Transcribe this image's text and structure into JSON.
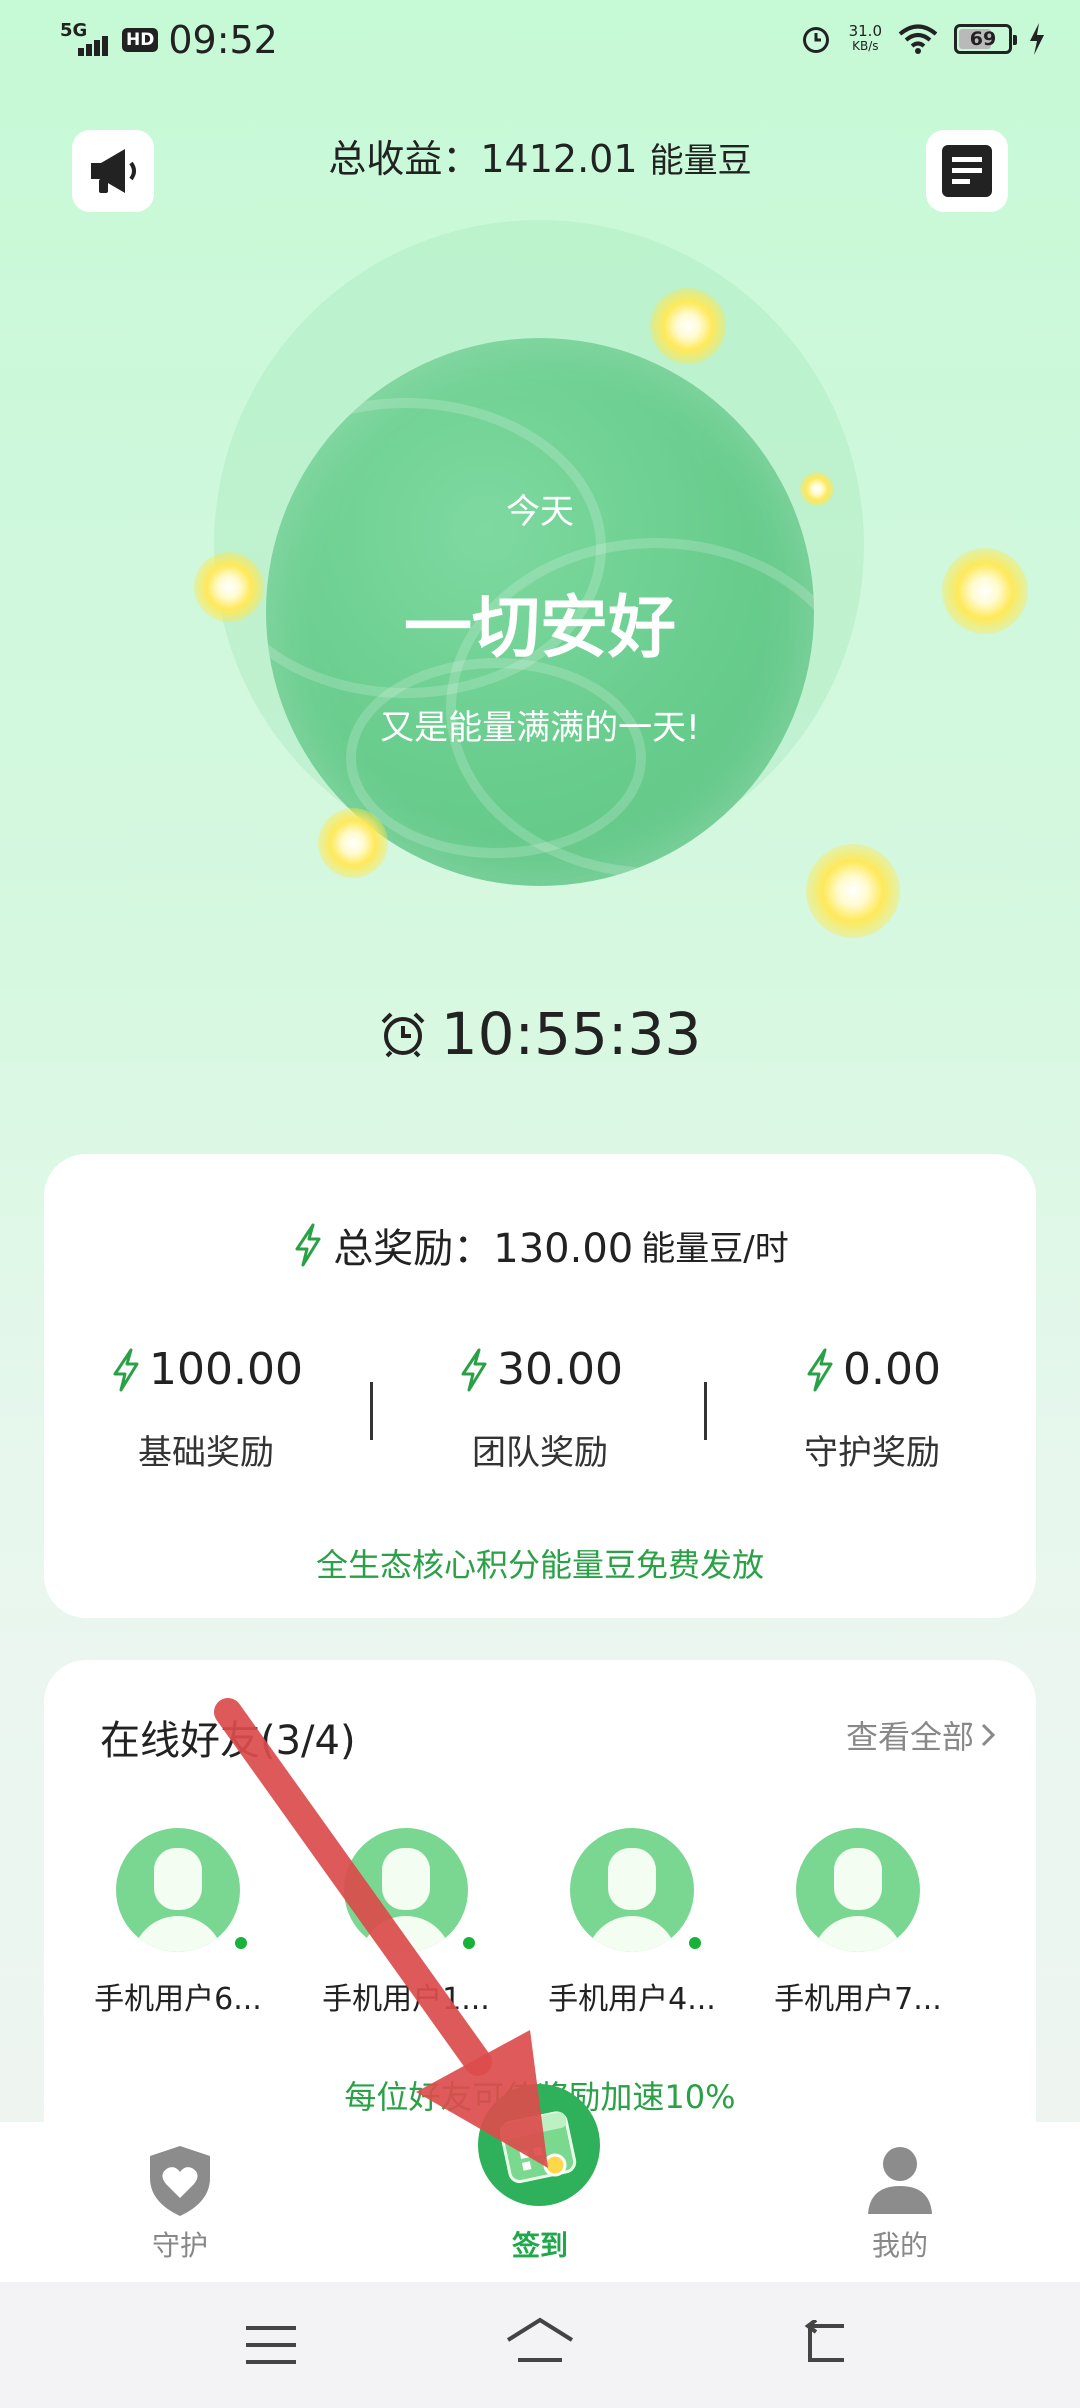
{
  "status_bar": {
    "network": "5G",
    "hd": "HD",
    "time": "09:52",
    "speed_value": "31.0",
    "speed_unit": "KB/s",
    "battery": "69"
  },
  "header": {
    "total_label": "总收益：1412.01",
    "total_unit": "能量豆"
  },
  "orb": {
    "line1": "今天",
    "line2": "一切安好",
    "line3": "又是能量满满的一天!"
  },
  "timer": "10:55:33",
  "reward_card": {
    "title": "总奖励：130.00",
    "unit": "能量豆/时",
    "stats": [
      {
        "value": "100.00",
        "label": "基础奖励"
      },
      {
        "value": "30.00",
        "label": "团队奖励"
      },
      {
        "value": "0.00",
        "label": "守护奖励"
      }
    ],
    "note": "全生态核心积分能量豆免费发放"
  },
  "friends_card": {
    "title": "在线好友(3/4)",
    "view_all": "查看全部",
    "friends": [
      {
        "name": "手机用户6...",
        "online": true
      },
      {
        "name": "手机用户1...",
        "online": true
      },
      {
        "name": "手机用户4...",
        "online": true
      },
      {
        "name": "手机用户7...",
        "online": false
      }
    ],
    "note": "每位好友可使奖励加速10%"
  },
  "bottom_nav": {
    "items": [
      {
        "label": "守护",
        "icon": "shield-heart-icon"
      },
      {
        "label": "签到",
        "icon": "calendar-check-icon"
      },
      {
        "label": "我的",
        "icon": "person-icon"
      }
    ]
  },
  "colors": {
    "accent_green": "#2aa146",
    "orb_green": "#67cc8c",
    "annotation_arrow": "#dc4c4c"
  }
}
